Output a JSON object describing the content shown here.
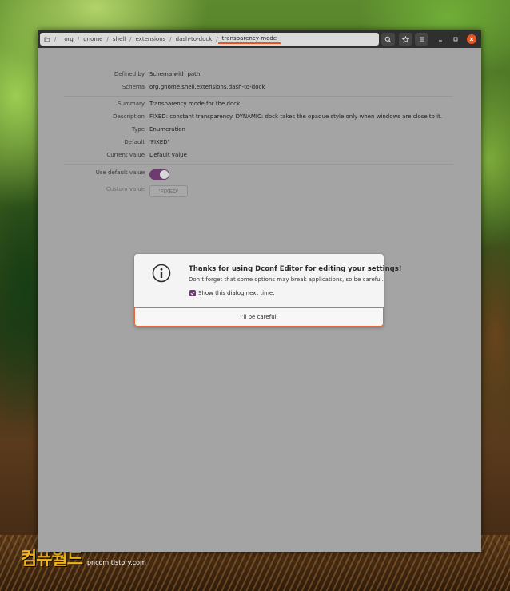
{
  "pathbar": {
    "crumbs": [
      "org",
      "gnome",
      "shell",
      "extensions",
      "dash-to-dock",
      "transparency-mode"
    ],
    "separator": "/"
  },
  "details": {
    "defined_by_label": "Defined by",
    "defined_by_value": "Schema with path",
    "schema_label": "Schema",
    "schema_value": "org.gnome.shell.extensions.dash-to-dock",
    "summary_label": "Summary",
    "summary_value": "Transparency mode for the dock",
    "description_label": "Description",
    "description_value": "FIXED: constant transparency. DYNAMIC: dock takes the opaque style only when windows are close to it.",
    "type_label": "Type",
    "type_value": "Enumeration",
    "default_label": "Default",
    "default_value": "'FIXED'",
    "current_label": "Current value",
    "current_value": "Default value",
    "use_default_label": "Use default value",
    "use_default_on": true,
    "custom_label": "Custom value",
    "custom_value": "'FIXED'"
  },
  "dialog": {
    "title": "Thanks for using Dconf Editor for editing your settings!",
    "message": "Don’t forget that some options may break applications, so be careful.",
    "checkbox_label": "Show this dialog next time.",
    "checkbox_checked": true,
    "button_label": "I’ll be careful."
  },
  "watermark": {
    "logo_part1": "컴퓨",
    "logo_part2": "월드",
    "url": "pncom.tistory.com"
  },
  "colors": {
    "accent": "#e95420",
    "toggle": "#6f3a70"
  }
}
